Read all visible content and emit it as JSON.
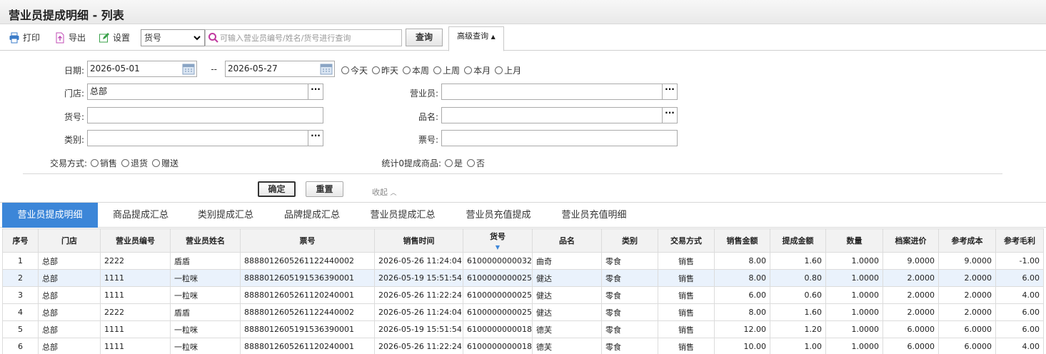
{
  "page_title": "营业员提成明细 - 列表",
  "toolbar": {
    "print_label": "打印",
    "export_label": "导出",
    "settings_label": "设置",
    "search_field_selected": "货号",
    "search_placeholder": "可输入营业员编号/姓名/货号进行查询",
    "query_label": "查询",
    "advanced_label": "高级查询"
  },
  "form": {
    "date_label": "日期:",
    "date_from": "2026-05-01",
    "date_sep": "--",
    "date_to": "2026-05-27",
    "quick_dates": [
      "今天",
      "昨天",
      "本周",
      "上周",
      "本月",
      "上月"
    ],
    "store_label": "门店:",
    "store_value": "总部",
    "clerk_label": "营业员:",
    "item_no_label": "货号:",
    "product_name_label": "品名:",
    "category_label": "类别:",
    "ticket_label": "票号:",
    "trade_type_label": "交易方式:",
    "trade_types": [
      "销售",
      "退货",
      "赠送"
    ],
    "zero_comm_label": "统计0提成商品:",
    "zero_comm_options": [
      "是",
      "否"
    ],
    "ok_label": "确定",
    "reset_label": "重置",
    "collapse_label": "收起"
  },
  "tabs": [
    "营业员提成明细",
    "商品提成汇总",
    "类别提成汇总",
    "品牌提成汇总",
    "营业员提成汇总",
    "营业员充值提成",
    "营业员充值明细"
  ],
  "table": {
    "columns": [
      "序号",
      "门店",
      "营业员编号",
      "营业员姓名",
      "票号",
      "销售时间",
      "货号",
      "品名",
      "类别",
      "交易方式",
      "销售金额",
      "提成金额",
      "数量",
      "档案进价",
      "参考成本",
      "参考毛利"
    ],
    "rows": [
      [
        "1",
        "总部",
        "2222",
        "盾盾",
        "888801260526112244000 2",
        "2026-05-26 11:24:04",
        "6100000000032",
        "曲奇",
        "零食",
        "销售",
        "8.00",
        "1.60",
        "1.0000",
        "9.0000",
        "9.0000",
        "-1.00"
      ],
      [
        "2",
        "总部",
        "1111",
        "一粒咪",
        "8888012605191536390001",
        "2026-05-19 15:51:54",
        "6100000000025",
        "健达",
        "零食",
        "销售",
        "8.00",
        "0.80",
        "1.0000",
        "2.0000",
        "2.0000",
        "6.00"
      ],
      [
        "3",
        "总部",
        "1111",
        "一粒咪",
        "8888012605261120240001",
        "2026-05-26 11:22:24",
        "6100000000025",
        "健达",
        "零食",
        "销售",
        "6.00",
        "0.60",
        "1.0000",
        "2.0000",
        "2.0000",
        "4.00"
      ],
      [
        "4",
        "总部",
        "2222",
        "盾盾",
        "8888012605261122440002",
        "2026-05-26 11:24:04",
        "6100000000025",
        "健达",
        "零食",
        "销售",
        "8.00",
        "1.60",
        "1.0000",
        "2.0000",
        "2.0000",
        "6.00"
      ],
      [
        "5",
        "总部",
        "1111",
        "一粒咪",
        "8888012605191536390001",
        "2026-05-19 15:51:54",
        "6100000000018",
        "德芙",
        "零食",
        "销售",
        "12.00",
        "1.20",
        "1.0000",
        "6.0000",
        "6.0000",
        "6.00"
      ],
      [
        "6",
        "总部",
        "1111",
        "一粒咪",
        "8888012605261120240001",
        "2026-05-26 11:22:24",
        "6100000000018",
        "德芙",
        "零食",
        "销售",
        "10.00",
        "1.00",
        "1.0000",
        "6.0000",
        "6.0000",
        "4.00"
      ]
    ]
  }
}
